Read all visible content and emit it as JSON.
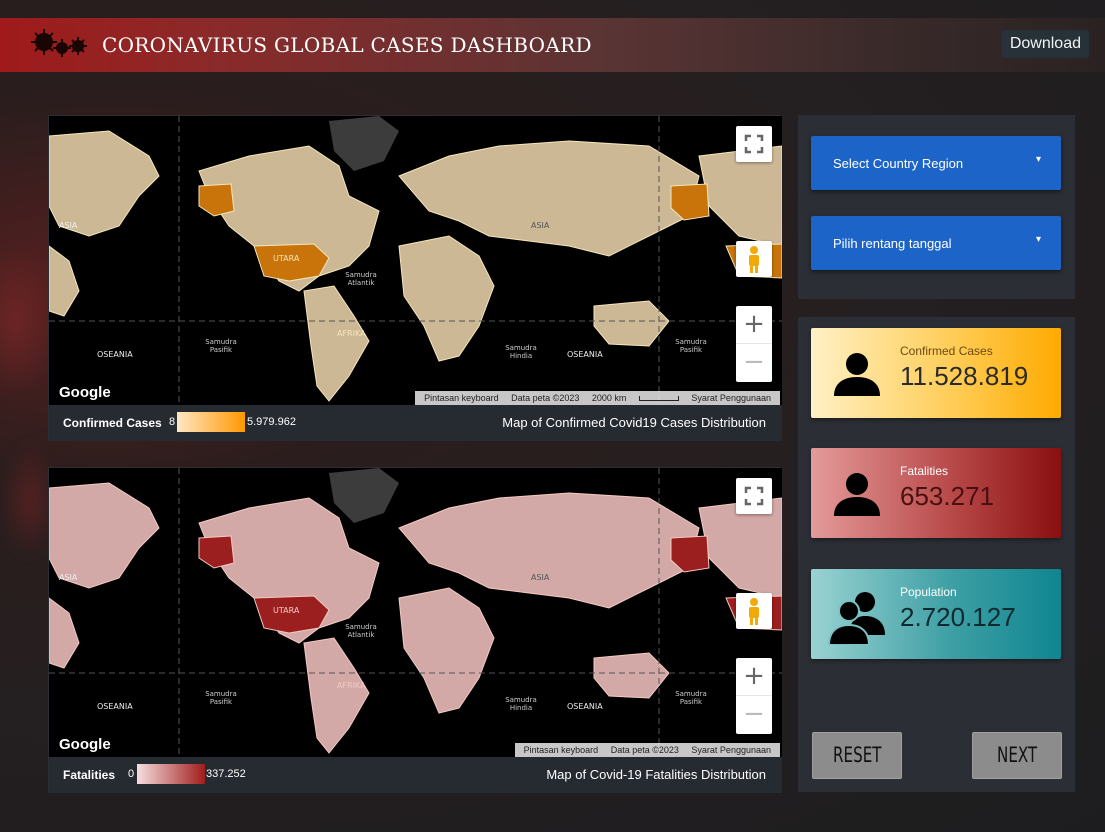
{
  "header": {
    "title": "CORONAVIRUS GLOBAL CASES DASHBOARD",
    "download_label": "Download"
  },
  "map_confirmed": {
    "legend_label": "Confirmed Cases",
    "legend_min": "8",
    "legend_max": "5.979.962",
    "caption": "Map of Confirmed Covid19 Cases Distribution",
    "attrib_keyboard": "Pintasan keyboard",
    "attrib_data": "Data peta ©2023",
    "attrib_scale": "2000 km",
    "attrib_terms": "Syarat Penggunaan",
    "colors": {
      "land": "#cdb896",
      "highlight": "#c8740a",
      "borders": "#f5e6b8",
      "scale_low": "#ffe6c4",
      "scale_high": "#ff9900"
    }
  },
  "map_fatalities": {
    "legend_label": "Fatalities",
    "legend_min": "0",
    "legend_max": "337.252",
    "caption": "Map of Covid-19 Fatalities Distribution",
    "attrib_keyboard": "Pintasan keyboard",
    "attrib_data": "Data peta ©2023",
    "attrib_terms": "Syarat Penggunaan",
    "colors": {
      "land": "#d3a9a7",
      "highlight": "#9c1f1f",
      "borders": "#f4c9c2",
      "scale_low": "#f6dede",
      "scale_high": "#a01c1c"
    }
  },
  "map_labels": {
    "brand": "Google",
    "asia": "ASIA",
    "utara": "UTARA",
    "atlantik": "Samudra Atlantik",
    "pasifik": "Samudra Pasifik",
    "hindia": "Samudra Hindia",
    "oseania": "OSEANIA",
    "afrika": "AFRIKA"
  },
  "controls": {
    "region_dropdown": "Select Country Region",
    "date_dropdown": "Pilih rentang tanggal",
    "zoom_in": "+",
    "zoom_out": "−"
  },
  "stats": {
    "confirmed": {
      "label": "Confirmed Cases",
      "value": "11.528.819",
      "icon": "person-icon"
    },
    "fatalities": {
      "label": "Fatalities",
      "value": "653.271",
      "icon": "person-icon"
    },
    "population": {
      "label": "Population",
      "value": "2.720.127",
      "icon": "people-icon"
    }
  },
  "buttons": {
    "reset": "RESET",
    "next": "NEXT"
  }
}
